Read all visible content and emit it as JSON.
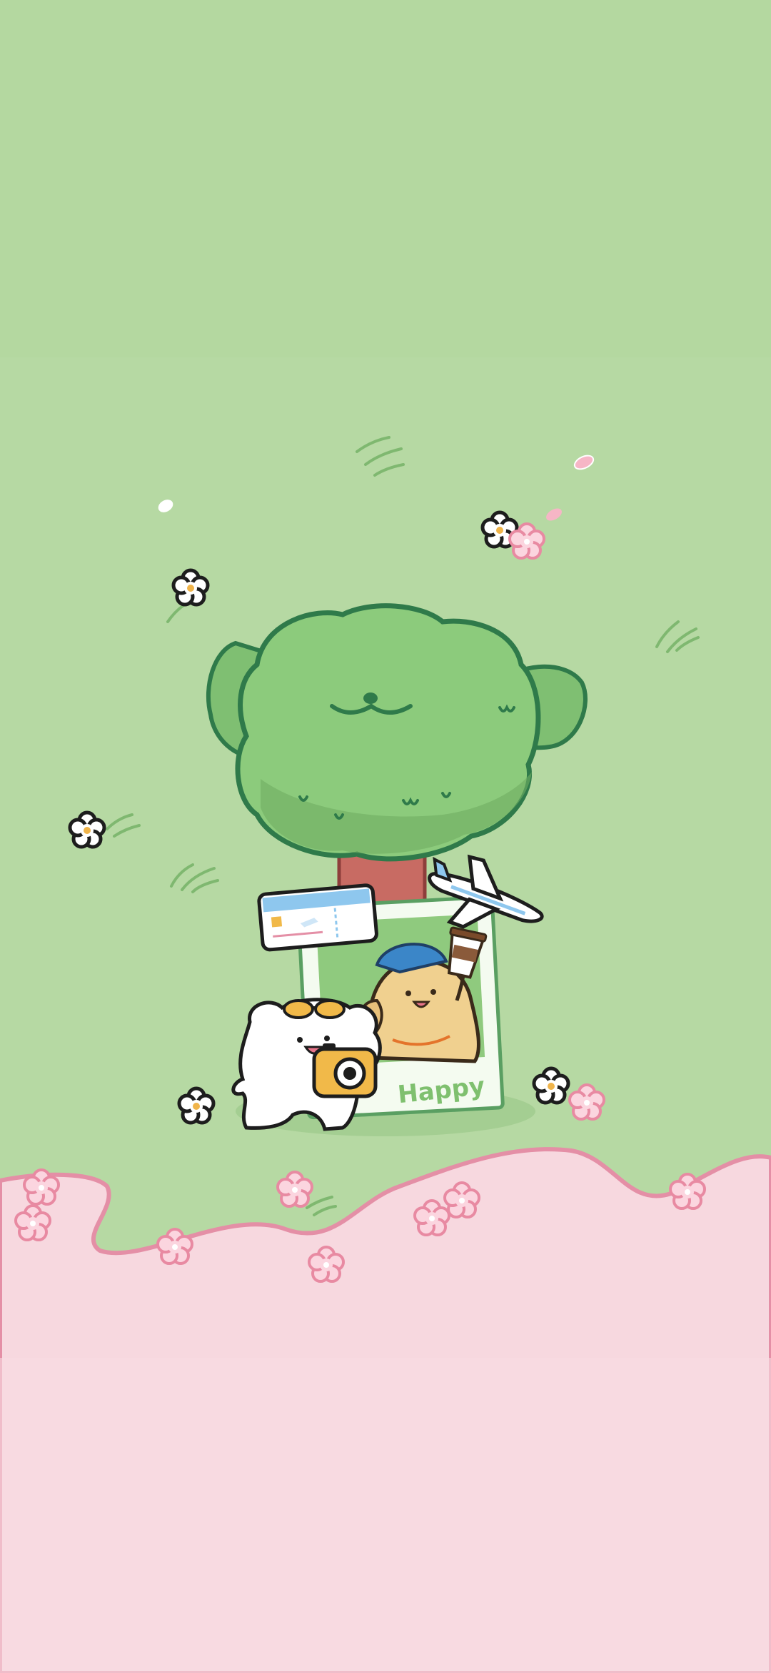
{
  "wallpaper": {
    "photo_caption": "Happy",
    "colors": {
      "grass": "#b6d9a3",
      "ground_pink": "#f7d8df",
      "ground_edge": "#e48fa6",
      "tree_leaves": "#7fbf72",
      "tree_outline": "#2f7a4a",
      "trunk": "#c86b63",
      "photo_frame": "#f4fbf0",
      "caption_green": "#7fc06f",
      "puppy_tan": "#f0d08f",
      "puppy_white": "#ffffff",
      "hat_blue": "#3b86c8",
      "camera_yellow": "#f1b949",
      "ticket_blue": "#8ec7ee",
      "blossom_pink": "#f6b6c6"
    },
    "icons": [
      "tree-dog-face",
      "plane-ticket-icon",
      "airplane-icon",
      "polaroid-photo-icon",
      "camera-icon",
      "sunglasses-icon",
      "coffee-cup-icon",
      "flower-icon"
    ]
  }
}
